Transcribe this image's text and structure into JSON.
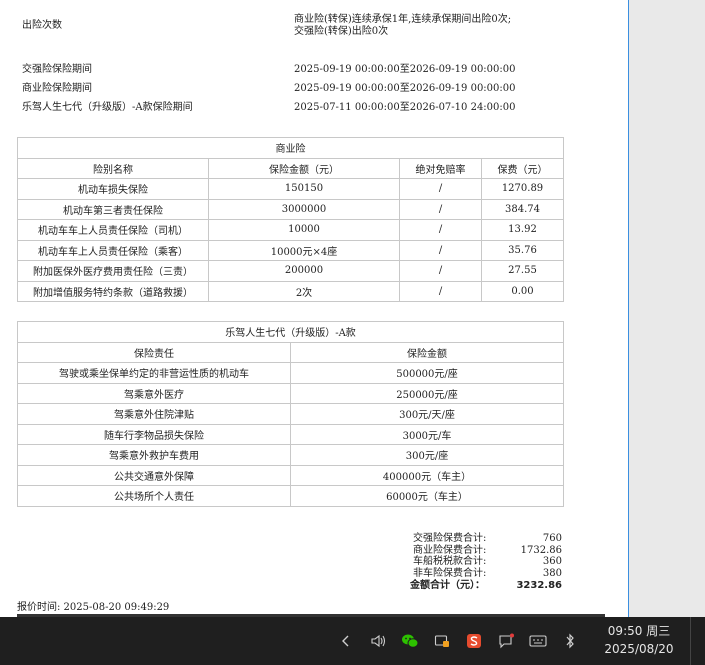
{
  "top_info": [
    {
      "label": "出险次数",
      "value": "商业险(转保)连续承保1年,连续承保期间出险0次;\n交强险(转保)出险0次"
    },
    {
      "label": "交强险保险期间",
      "value": "2025-09-19 00:00:00至2026-09-19 00:00:00"
    },
    {
      "label": "商业险保险期间",
      "value": "2025-09-19 00:00:00至2026-09-19 00:00:00"
    },
    {
      "label": "乐驾人生七代（升级版）-A款保险期间",
      "value": "2025-07-11 00:00:00至2026-07-10 24:00:00"
    }
  ],
  "commercial": {
    "title": "商业险",
    "headers": [
      "险别名称",
      "保险金额（元）",
      "绝对免赔率",
      "保费（元）"
    ],
    "rows": [
      [
        "机动车损失保险",
        "150150",
        "/",
        "1270.89"
      ],
      [
        "机动车第三者责任保险",
        "3000000",
        "/",
        "384.74"
      ],
      [
        "机动车车上人员责任保险（司机）",
        "10000",
        "/",
        "13.92"
      ],
      [
        "机动车车上人员责任保险（乘客）",
        "10000元×4座",
        "/",
        "35.76"
      ],
      [
        "附加医保外医疗费用责任险（三责）",
        "200000",
        "/",
        "27.55"
      ],
      [
        "附加增值服务特约条款（道路救援）",
        "2次",
        "/",
        "0.00"
      ]
    ]
  },
  "lejia": {
    "title": "乐驾人生七代（升级版）-A款",
    "headers": [
      "保险责任",
      "保险金额"
    ],
    "rows": [
      [
        "驾驶或乘坐保单约定的非营运性质的机动车",
        "500000元/座"
      ],
      [
        "驾乘意外医疗",
        "250000元/座"
      ],
      [
        "驾乘意外住院津贴",
        "300元/天/座"
      ],
      [
        "随车行李物品损失保险",
        "3000元/车"
      ],
      [
        "驾乘意外救护车费用",
        "300元/座"
      ],
      [
        "公共交通意外保障",
        "400000元（车主）"
      ],
      [
        "公共场所个人责任",
        "60000元（车主）"
      ]
    ]
  },
  "summary": [
    {
      "label": "交强险保费合计:",
      "value": "760"
    },
    {
      "label": "商业险保费合计:",
      "value": "1732.86"
    },
    {
      "label": "车船税税款合计:",
      "value": "360"
    },
    {
      "label": "非车险保费合计:",
      "value": "380"
    }
  ],
  "total": {
    "label": "金额合计（元）：",
    "value": "3232.86"
  },
  "quote_time": "报价时间:  2025-08-20 09:49:29",
  "taskbar": {
    "time": "09:50 周三",
    "date": "2025/08/20",
    "icons": [
      "chevron-left-icon",
      "speaker-icon",
      "wechat-icon",
      "screen-share-icon",
      "s-app-icon",
      "message-icon",
      "keyboard-icon",
      "bluetooth-icon"
    ]
  }
}
